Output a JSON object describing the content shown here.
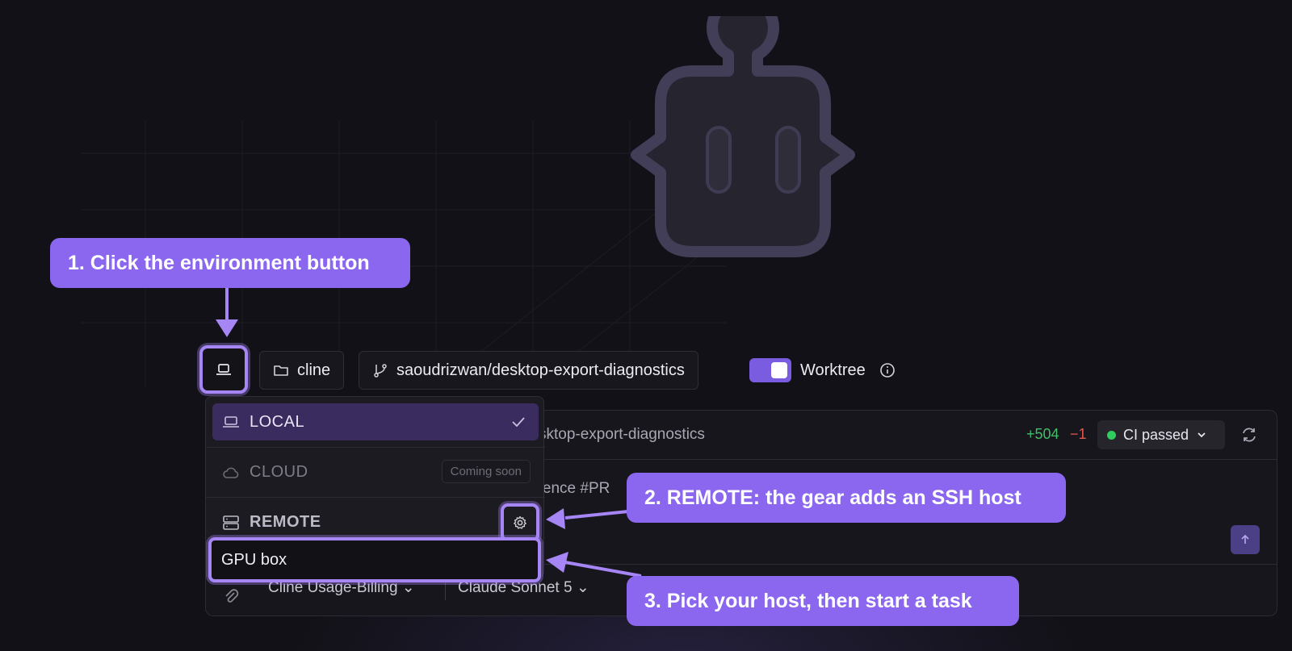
{
  "toolbar": {
    "folder_label": "cline",
    "branch_label": "saoudrizwan/desktop-export-diagnostics",
    "worktree_label": "Worktree",
    "worktree_enabled": true
  },
  "environment_menu": {
    "local_label": "LOCAL",
    "local_selected": true,
    "cloud_label": "CLOUD",
    "cloud_badge": "Coming soon",
    "remote_label": "REMOTE",
    "host_label": "GPU box"
  },
  "composer": {
    "branch_text": "sktop-export-diagnostics",
    "diff_added": "+504",
    "diff_removed": "−1",
    "ci_status": "CI passed",
    "prompt_text": "erence #PR",
    "account_select": "Cline Usage-Billing",
    "model_select": "Claude Sonnet 5"
  },
  "callouts": {
    "step1": "1. Click the environment button",
    "step2": "2. REMOTE: the gear adds an SSH host",
    "step3": "3. Pick your host, then start a task"
  },
  "colors": {
    "accent": "#a685f5",
    "callout": "#8b67f0",
    "added": "#3fbf6a",
    "removed": "#e0584f",
    "ci_ok": "#2fcc5e"
  },
  "icons": [
    "robot-logo-icon",
    "laptop-icon",
    "folder-icon",
    "git-branch-icon",
    "info-icon",
    "check-icon",
    "cloud-icon",
    "server-icon",
    "gear-icon",
    "chevron-down-icon",
    "refresh-icon",
    "arrow-up-icon",
    "paperclip-icon"
  ]
}
